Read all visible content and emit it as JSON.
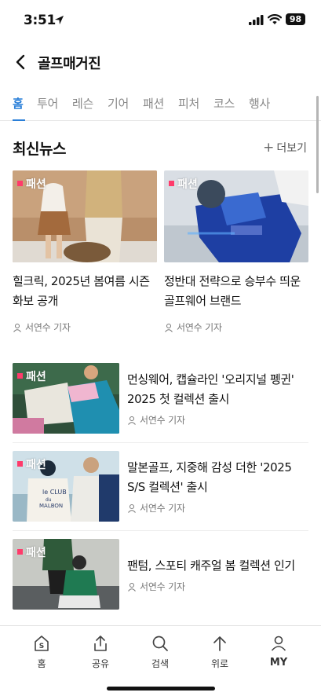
{
  "status_bar": {
    "time": "3:51",
    "battery": "98"
  },
  "header": {
    "title": "골프매거진"
  },
  "tabs": [
    {
      "label": "홈",
      "active": true
    },
    {
      "label": "투어"
    },
    {
      "label": "레슨"
    },
    {
      "label": "기어"
    },
    {
      "label": "패션"
    },
    {
      "label": "피처"
    },
    {
      "label": "코스"
    },
    {
      "label": "행사"
    }
  ],
  "section": {
    "title": "최신뉴스",
    "more": "더보기"
  },
  "featured": [
    {
      "badge": "패션",
      "title_line1": "힐크릭, 2025년 봄여름 시즌",
      "title_line2": "화보 공개",
      "author": "서연수 기자"
    },
    {
      "badge": "패션",
      "title_line1": "정반대 전략으로 승부수 띄운",
      "title_line2": "골프웨어 브랜드",
      "author": "서연수 기자"
    }
  ],
  "list": [
    {
      "badge": "패션",
      "title_line1": "먼싱웨어, 캡슐라인 '오리지널 펭귄'",
      "title_line2": "2025 첫 컬렉션 출시",
      "author": "서연수 기자"
    },
    {
      "badge": "패션",
      "title_line1": "말본골프, 지중해 감성 더한 '2025",
      "title_line2": "S/S 컬렉션' 출시",
      "author": "서연수 기자",
      "image_text": "le CLUB du MALBON"
    },
    {
      "badge": "패션",
      "title_line1": "팬텀, 스포티 캐주얼 봄 컬렉션 인기",
      "author": "서연수 기자"
    }
  ],
  "bottom_nav": [
    {
      "label": "홈",
      "icon": "home-s-icon"
    },
    {
      "label": "공유",
      "icon": "share-icon"
    },
    {
      "label": "검색",
      "icon": "search-icon"
    },
    {
      "label": "위로",
      "icon": "arrow-up-icon"
    },
    {
      "label": "MY",
      "icon": "person-icon"
    }
  ],
  "colors": {
    "accent": "#2a7fd8",
    "badge": "#ff3b6b"
  }
}
